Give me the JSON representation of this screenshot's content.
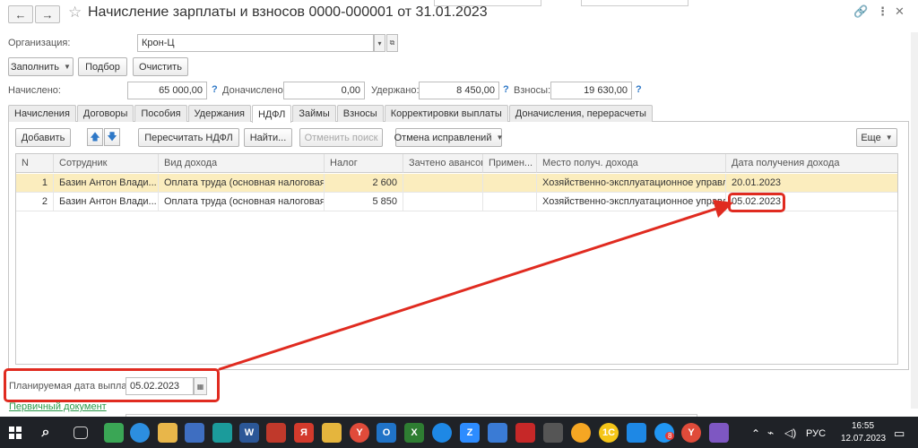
{
  "window": {
    "title": "Начисление зарплаты и взносов 0000-000001 от 31.01.2023",
    "back_icon": "←",
    "forward_icon": "→",
    "star_icon": "☆",
    "link_icon": "🔗",
    "more_icon": "⋮",
    "close_icon": "✕"
  },
  "form": {
    "org_label": "Организация:",
    "org_value": "Крон-Ц",
    "buttons": {
      "fill": "Заполнить",
      "pick": "Подбор",
      "clear": "Очистить"
    },
    "totals": {
      "accrued_label": "Начислено:",
      "accrued_value": "65 000,00",
      "extra_label": "Доначислено:",
      "extra_value": "0,00",
      "withheld_label": "Удержано:",
      "withheld_value": "8 450,00",
      "contrib_label": "Взносы:",
      "contrib_value": "19 630,00",
      "help_icon": "?"
    }
  },
  "tabs": [
    "Начисления",
    "Договоры",
    "Пособия",
    "Удержания",
    "НДФЛ",
    "Займы",
    "Взносы",
    "Корректировки выплаты",
    "Доначисления, перерасчеты"
  ],
  "active_tab": "НДФЛ",
  "toolbar": {
    "add": "Добавить",
    "up_icon": "🡅",
    "down_icon": "🡇",
    "recalc": "Пересчитать НДФЛ",
    "find": "Найти...",
    "cancel_search": "Отменить поиск",
    "undo_fixes": "Отмена исправлений",
    "more": "Еще"
  },
  "table": {
    "columns": [
      "N",
      "Сотрудник",
      "Вид дохода",
      "Налог",
      "Зачтено авансов",
      "Примен...",
      "Место получ. дохода",
      "Дата получения дохода"
    ],
    "rows": [
      {
        "n": "1",
        "employee": "Базин Антон Влади...",
        "income": "Оплата труда (основная налоговая ...",
        "tax": "2 600",
        "advances": "",
        "applied": "",
        "place": "Хозяйственно-эксплуатационное управле...",
        "date": "20.01.2023"
      },
      {
        "n": "2",
        "employee": "Базин Антон Влади...",
        "income": "Оплата труда (основная налоговая ...",
        "tax": "5 850",
        "advances": "",
        "applied": "",
        "place": "Хозяйственно-эксплуатационное управле...",
        "date": "05.02.2023"
      }
    ]
  },
  "footer": {
    "pay_date_label": "Планируемая дата выплаты:",
    "pay_date_value": "05.02.2023",
    "calendar_icon": "▦",
    "primary_doc_link": "Первичный документ"
  },
  "taskbar": {
    "search_icon": "⌕",
    "lang": "РУС",
    "time": "16:55",
    "date": "12.07.2023",
    "badge": "8",
    "colors": {
      "bar": "#1f2227",
      "accent_red": "#e02b20"
    }
  }
}
